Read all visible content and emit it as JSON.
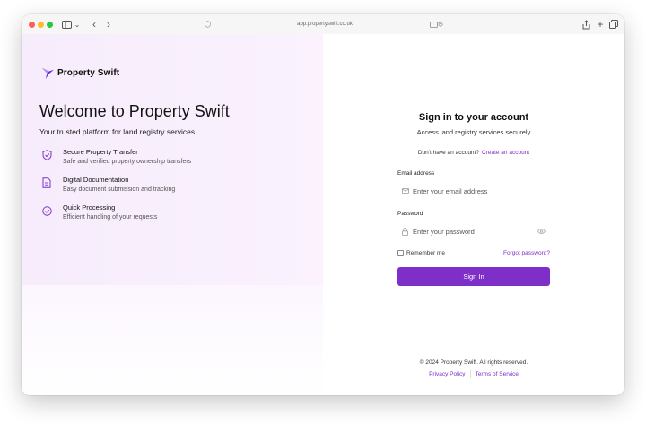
{
  "browser": {
    "url": "app.propertyswift.co.uk"
  },
  "brand": {
    "name": "Property Swift",
    "accent_color": "#7e2fc7"
  },
  "hero": {
    "title": "Welcome to Property Swift",
    "subtitle": "Your trusted platform for land registry services"
  },
  "features": [
    {
      "icon": "shield-check-icon",
      "title": "Secure Property Transfer",
      "desc": "Safe and verified property ownership transfers"
    },
    {
      "icon": "document-icon",
      "title": "Digital Documentation",
      "desc": "Easy document submission and tracking"
    },
    {
      "icon": "check-circle-icon",
      "title": "Quick Processing",
      "desc": "Efficient handling of your requests"
    }
  ],
  "signin": {
    "title": "Sign in to your account",
    "subtitle": "Access land registry services securely",
    "no_account": "Don't have an account?",
    "create_account": "Create an account",
    "email_label": "Email address",
    "email_placeholder": "Enter your email address",
    "password_label": "Password",
    "password_placeholder": "Enter your password",
    "remember": "Remember me",
    "forgot": "Forgot password?",
    "button": "Sign In"
  },
  "footer": {
    "copyright": "© 2024 Property Swift. All rights reserved.",
    "privacy": "Privacy Policy",
    "terms": "Terms of Service"
  }
}
